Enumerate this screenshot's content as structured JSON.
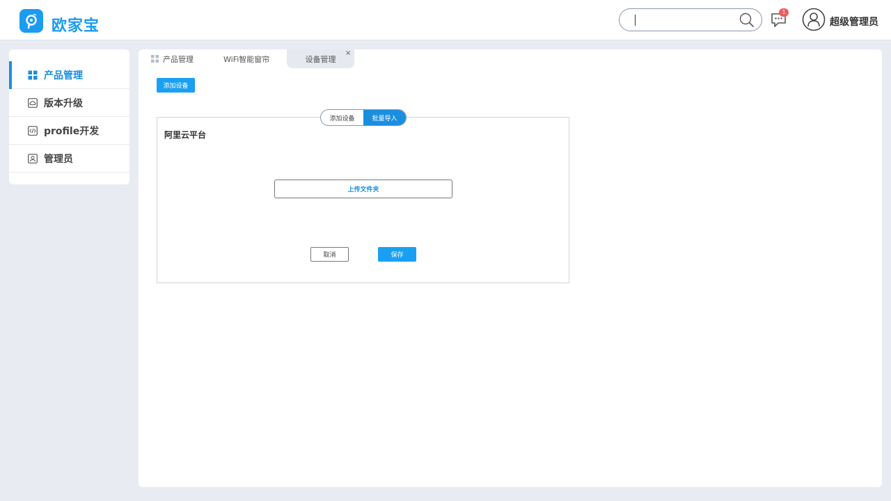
{
  "app": {
    "brand": "欧家宝"
  },
  "header": {
    "search": {
      "placeholder": "",
      "value": ""
    },
    "notifications": {
      "count": "1"
    },
    "user": {
      "name": "超级管理员"
    }
  },
  "sidebar": {
    "items": [
      {
        "label": "产品管理",
        "icon": "grid-icon",
        "active": true
      },
      {
        "label": "版本升级",
        "icon": "cloud-upload-icon",
        "active": false
      },
      {
        "label": "profile开发",
        "icon": "code-icon",
        "active": false
      },
      {
        "label": "管理员",
        "icon": "user-card-icon",
        "active": false
      }
    ]
  },
  "tabs": [
    {
      "label": "产品管理",
      "icon": "grid-icon"
    },
    {
      "label": "WiFi智能窗帘"
    },
    {
      "label": "设备管理",
      "active": true,
      "closable": true,
      "close": "×"
    }
  ],
  "toolbar": {
    "add_device_label": "添加设备"
  },
  "form": {
    "segment": {
      "options": [
        "添加设备",
        "批量导入"
      ],
      "selected": "批量导入"
    },
    "platform_label": "阿里云平台",
    "upload_label": "上传文件夹",
    "cancel_label": "取消",
    "save_label": "保存"
  },
  "colors": {
    "accent": "#1a8fe0",
    "button": "#1aa0f2",
    "badge": "#f25b5b",
    "background": "#e8ebf1"
  }
}
